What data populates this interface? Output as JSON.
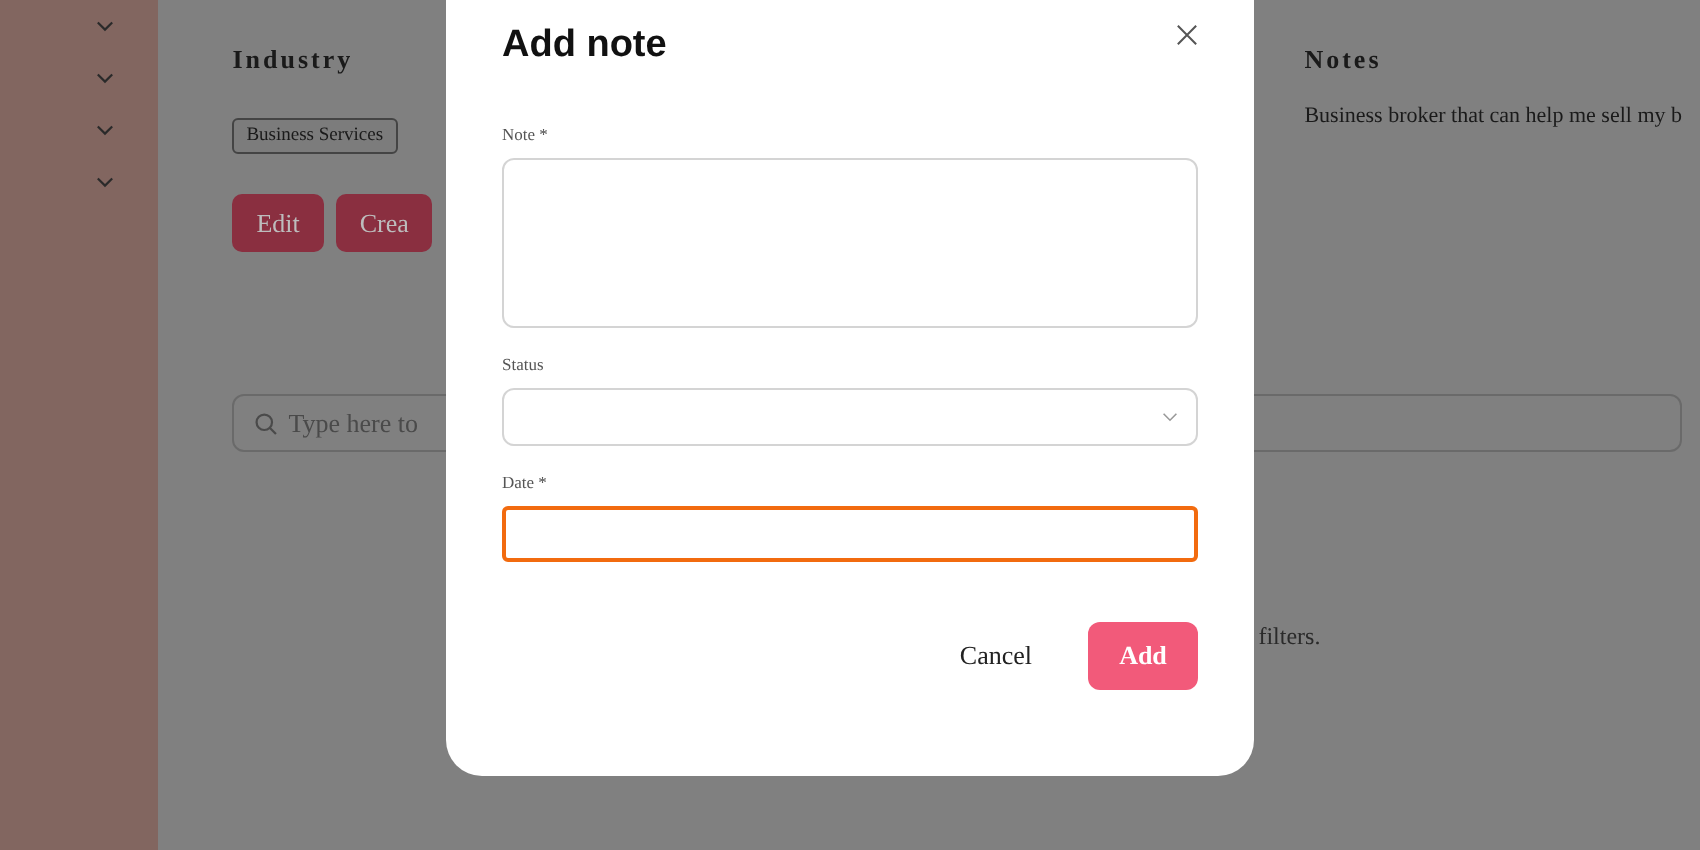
{
  "sidebar": {
    "items": [
      {
        "expanded": false
      },
      {
        "expanded": false
      },
      {
        "expanded": false
      },
      {
        "expanded": false
      }
    ]
  },
  "industry": {
    "title": "Industry",
    "tag": "Business Services",
    "buttons": [
      "Edit",
      "Crea"
    ]
  },
  "notes": {
    "title": "Notes",
    "text": "Business broker that can help me sell my b"
  },
  "search": {
    "placeholder": "Type here to"
  },
  "empty_message": "filters.",
  "dialog": {
    "title": "Add note",
    "fields": [
      {
        "kind": "textarea",
        "label": "Note *",
        "focused": false
      },
      {
        "kind": "select",
        "label": "Status",
        "focused": false
      },
      {
        "kind": "input",
        "label": "Date *",
        "focused": true
      }
    ],
    "buttons": [
      "Cancel",
      "Add"
    ]
  }
}
